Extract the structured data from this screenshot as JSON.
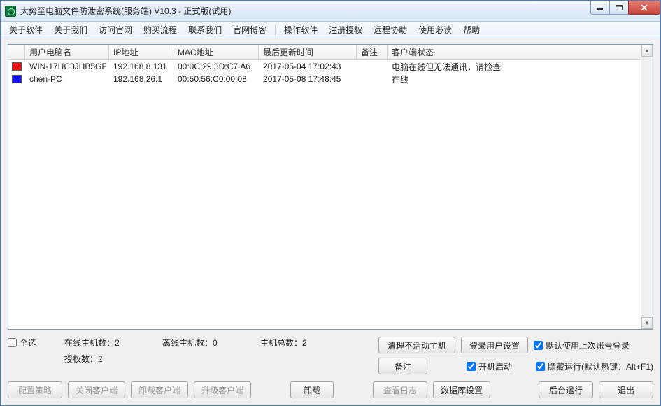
{
  "titlebar": {
    "title": "大势至电脑文件防泄密系统(服务端) V10.3 - 正式版(试用)"
  },
  "menu": {
    "about_software": "关于软件",
    "about_us": "关于我们",
    "visit_site": "访问官网",
    "buy_flow": "购买流程",
    "contact_us": "联系我们",
    "official_blog": "官网博客",
    "operate_software": "操作软件",
    "register_auth": "注册授权",
    "remote_assist": "远程协助",
    "must_read": "使用必读",
    "help": "帮助"
  },
  "columns": {
    "name": "用户电脑名",
    "ip": "IP地址",
    "mac": "MAC地址",
    "time": "最后更新时间",
    "note": "备注",
    "status": "客户端状态"
  },
  "rows": [
    {
      "icon": "red",
      "name": "WIN-17HC3JHB5GF",
      "ip": "192.168.8.131",
      "mac": "00:0C:29:3D:C7:A6",
      "time": "2017-05-04 17:02:43",
      "note": "",
      "status": "电脑在线但无法通讯，请检查"
    },
    {
      "icon": "blue",
      "name": "chen-PC",
      "ip": "192.168.26.1",
      "mac": "00:50:56:C0:00:08",
      "time": "2017-05-08 17:48:45",
      "note": "",
      "status": "在线"
    }
  ],
  "bottom": {
    "select_all": "全选",
    "online_count_label": "在线主机数：",
    "online_count": "2",
    "offline_count_label": "离线主机数：",
    "offline_count": "0",
    "total_count_label": "主机总数：",
    "total_count": "2",
    "license_count_label": "授权数：",
    "license_count": "2",
    "clear_inactive": "清理不活动主机",
    "login_user_settings": "登录用户设置",
    "note_btn": "备注",
    "use_last_login": "默认使用上次账号登录",
    "startup": "开机启动",
    "hidden_run": "隐藏运行(默认热键：Alt+F1)",
    "config_policy": "配置策略",
    "close_client": "关闭客户端",
    "uninstall_client": "卸载客户端",
    "upgrade_client": "升级客户端",
    "uninstall": "卸载",
    "view_log": "查看日志",
    "db_settings": "数据库设置",
    "run_background": "后台运行",
    "exit": "退出"
  }
}
